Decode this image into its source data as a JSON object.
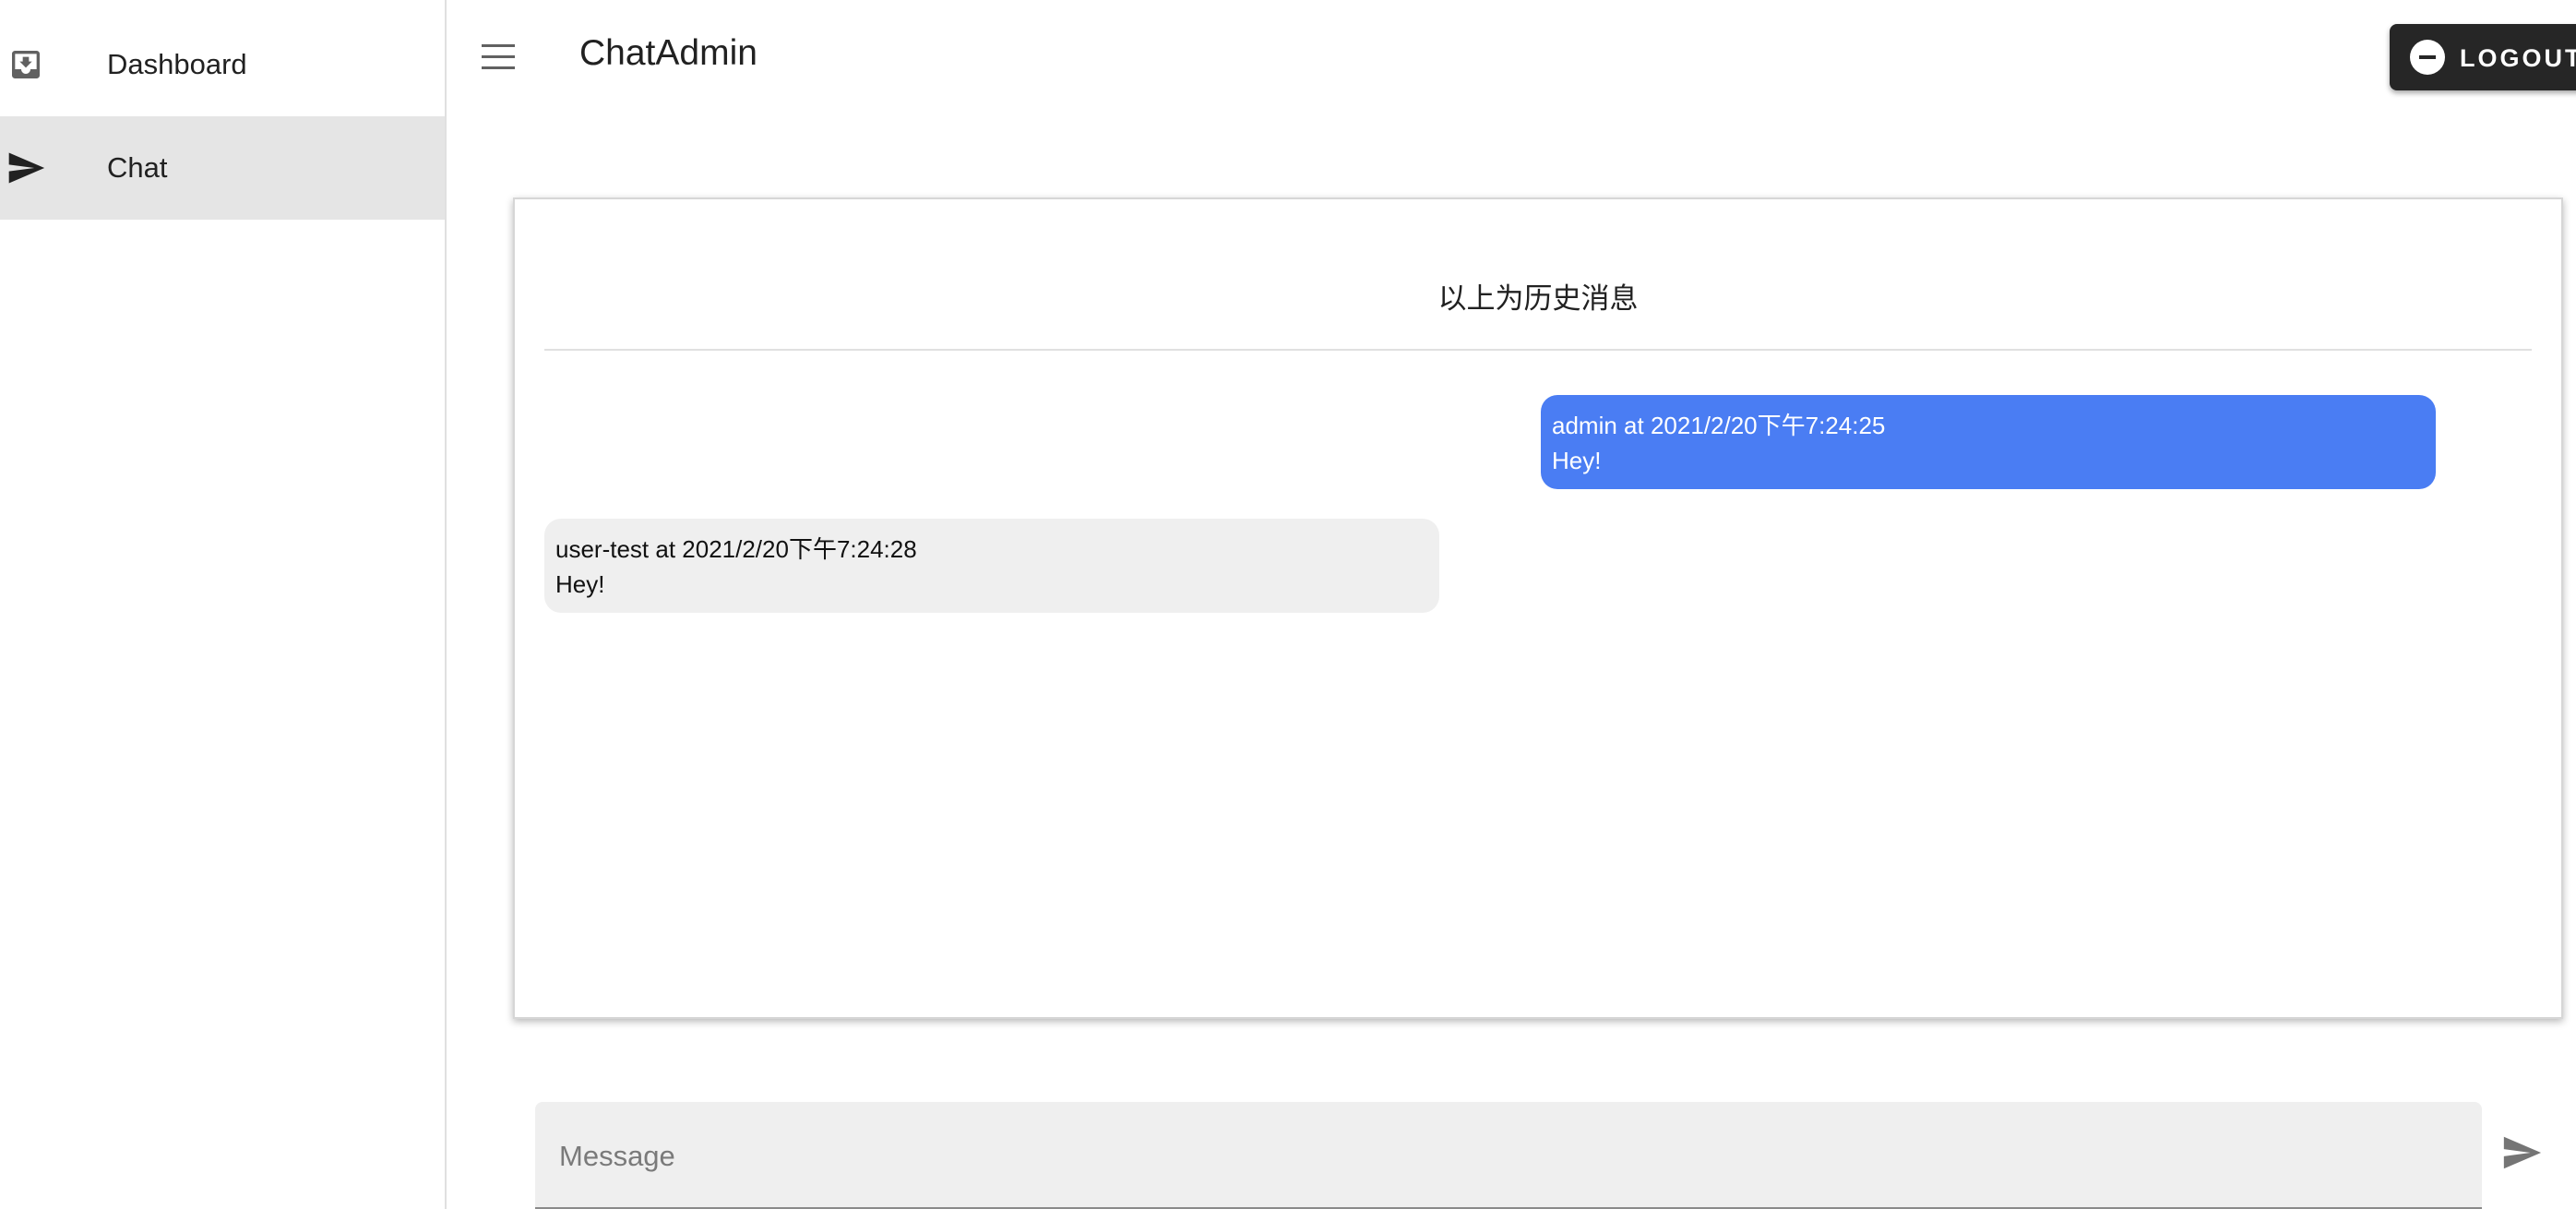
{
  "app": {
    "title": "ChatAdmin"
  },
  "sidebar": {
    "items": [
      {
        "label": "Dashboard",
        "icon": "inbox-download-icon",
        "active": false
      },
      {
        "label": "Chat",
        "icon": "send-icon",
        "active": true
      }
    ]
  },
  "header": {
    "menu_icon": "menu-icon",
    "logout_label": "LOGOUT",
    "logout_icon": "remove-circle-icon"
  },
  "chat": {
    "history_label": "以上为历史消息",
    "messages": [
      {
        "sender_line": "admin at 2021/2/20下午7:24:25",
        "text": "Hey!",
        "direction": "outgoing"
      },
      {
        "sender_line": "user-test at 2021/2/20下午7:24:28",
        "text": "Hey!",
        "direction": "incoming"
      }
    ]
  },
  "composer": {
    "placeholder": "Message",
    "value": "",
    "send_icon": "send-icon"
  },
  "colors": {
    "outgoing_bubble": "#4a7df3",
    "incoming_bubble": "#efefef",
    "active_nav": "#e5e5e5",
    "logout_bg": "#262626"
  }
}
